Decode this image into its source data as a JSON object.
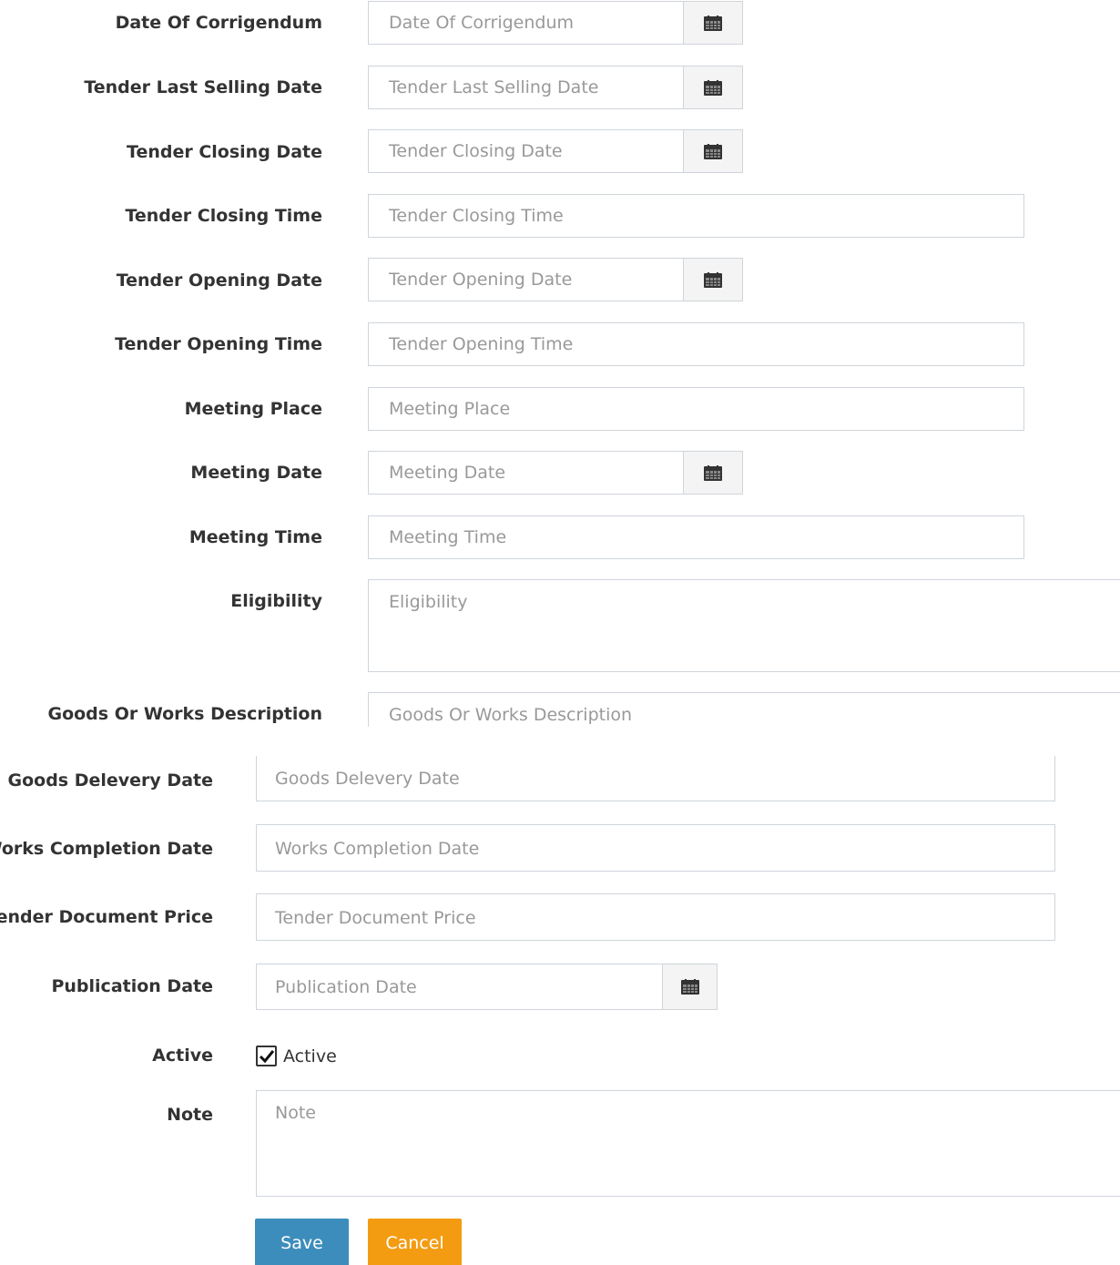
{
  "form": {
    "date_of_corrigendum": {
      "label": "Date Of Corrigendum",
      "placeholder": "Date Of Corrigendum"
    },
    "tender_last_selling_date": {
      "label": "Tender Last Selling Date",
      "placeholder": "Tender Last Selling Date"
    },
    "tender_closing_date": {
      "label": "Tender Closing Date",
      "placeholder": "Tender Closing Date"
    },
    "tender_closing_time": {
      "label": "Tender Closing Time",
      "placeholder": "Tender Closing Time"
    },
    "tender_opening_date": {
      "label": "Tender Opening Date",
      "placeholder": "Tender Opening Date"
    },
    "tender_opening_time": {
      "label": "Tender Opening Time",
      "placeholder": "Tender Opening Time"
    },
    "meeting_place": {
      "label": "Meeting Place",
      "placeholder": "Meeting Place"
    },
    "meeting_date": {
      "label": "Meeting Date",
      "placeholder": "Meeting Date"
    },
    "meeting_time": {
      "label": "Meeting Time",
      "placeholder": "Meeting Time"
    },
    "eligibility": {
      "label": "Eligibility",
      "placeholder": "Eligibility"
    },
    "goods_or_works_description": {
      "label": "Goods Or Works Description",
      "placeholder": "Goods Or Works Description"
    },
    "goods_delevery_date": {
      "label": "Goods Delevery Date",
      "placeholder": "Goods Delevery Date"
    },
    "works_completion_date": {
      "label": "Works Completion Date",
      "placeholder": "Works Completion Date"
    },
    "tender_document_price": {
      "label": "Tender Document Price",
      "placeholder": "Tender Document Price"
    },
    "publication_date": {
      "label": "Publication Date",
      "placeholder": "Publication Date"
    },
    "active": {
      "label": "Active",
      "checkbox_label": "Active",
      "checked": true
    },
    "note": {
      "label": "Note",
      "placeholder": "Note"
    }
  },
  "buttons": {
    "save": "Save",
    "cancel": "Cancel"
  },
  "icons": {
    "calendar": "calendar-icon",
    "checkmark": "checkmark-icon"
  },
  "colors": {
    "save_button": "#3c8dbc",
    "cancel_button": "#f39c12",
    "label_text": "#333333",
    "placeholder_text": "#999999",
    "input_border": "#cfd5db"
  }
}
